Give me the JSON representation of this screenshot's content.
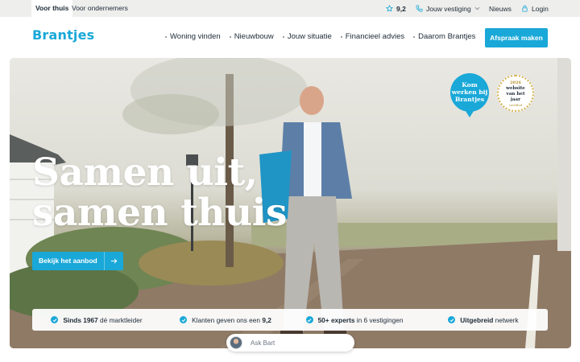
{
  "topbar": {
    "audience_tabs": [
      {
        "label": "Voor thuis",
        "active": true
      },
      {
        "label": "Voor ondernemers",
        "active": false
      }
    ],
    "rating": "9,2",
    "vestiging_label": "Jouw vestiging",
    "news_label": "Nieuws",
    "login_label": "Login"
  },
  "header": {
    "logo_text": "Brantjes",
    "nav": [
      {
        "label": "Woning vinden"
      },
      {
        "label": "Nieuwbouw"
      },
      {
        "label": "Jouw situatie"
      },
      {
        "label": "Financieel advies"
      },
      {
        "label": "Daarom Brantjes"
      }
    ],
    "cta_label": "Afspraak maken"
  },
  "hero": {
    "title_line1": "Samen uit,",
    "title_line2": "samen thuis",
    "button_label": "Bekijk het aanbod",
    "badge_work": {
      "line1": "Kom",
      "line2": "werken bij",
      "line3": "Brantjes"
    },
    "badge_award": {
      "year": "2026",
      "line1": "website",
      "line2": "van het",
      "line3": "jaar",
      "sub": "certified"
    }
  },
  "usps": [
    {
      "bold": "Sinds 1967",
      "text": " dé marktleider"
    },
    {
      "pre": "Klanten geven ons een ",
      "bold": "9,2"
    },
    {
      "bold": "50+ experts",
      "text": " in 6 vestigingen"
    },
    {
      "bold": "Uitgebreid",
      "text": " netwerk"
    }
  ],
  "chat": {
    "label": "Ask Bart"
  },
  "colors": {
    "brand": "#19a8d8",
    "text": "#1d2a36",
    "topbar_bg": "#eeeeec"
  },
  "icons": [
    "star-icon",
    "phone-icon",
    "chevron-down-icon",
    "lock-icon",
    "arrow-right-icon",
    "check-icon"
  ]
}
